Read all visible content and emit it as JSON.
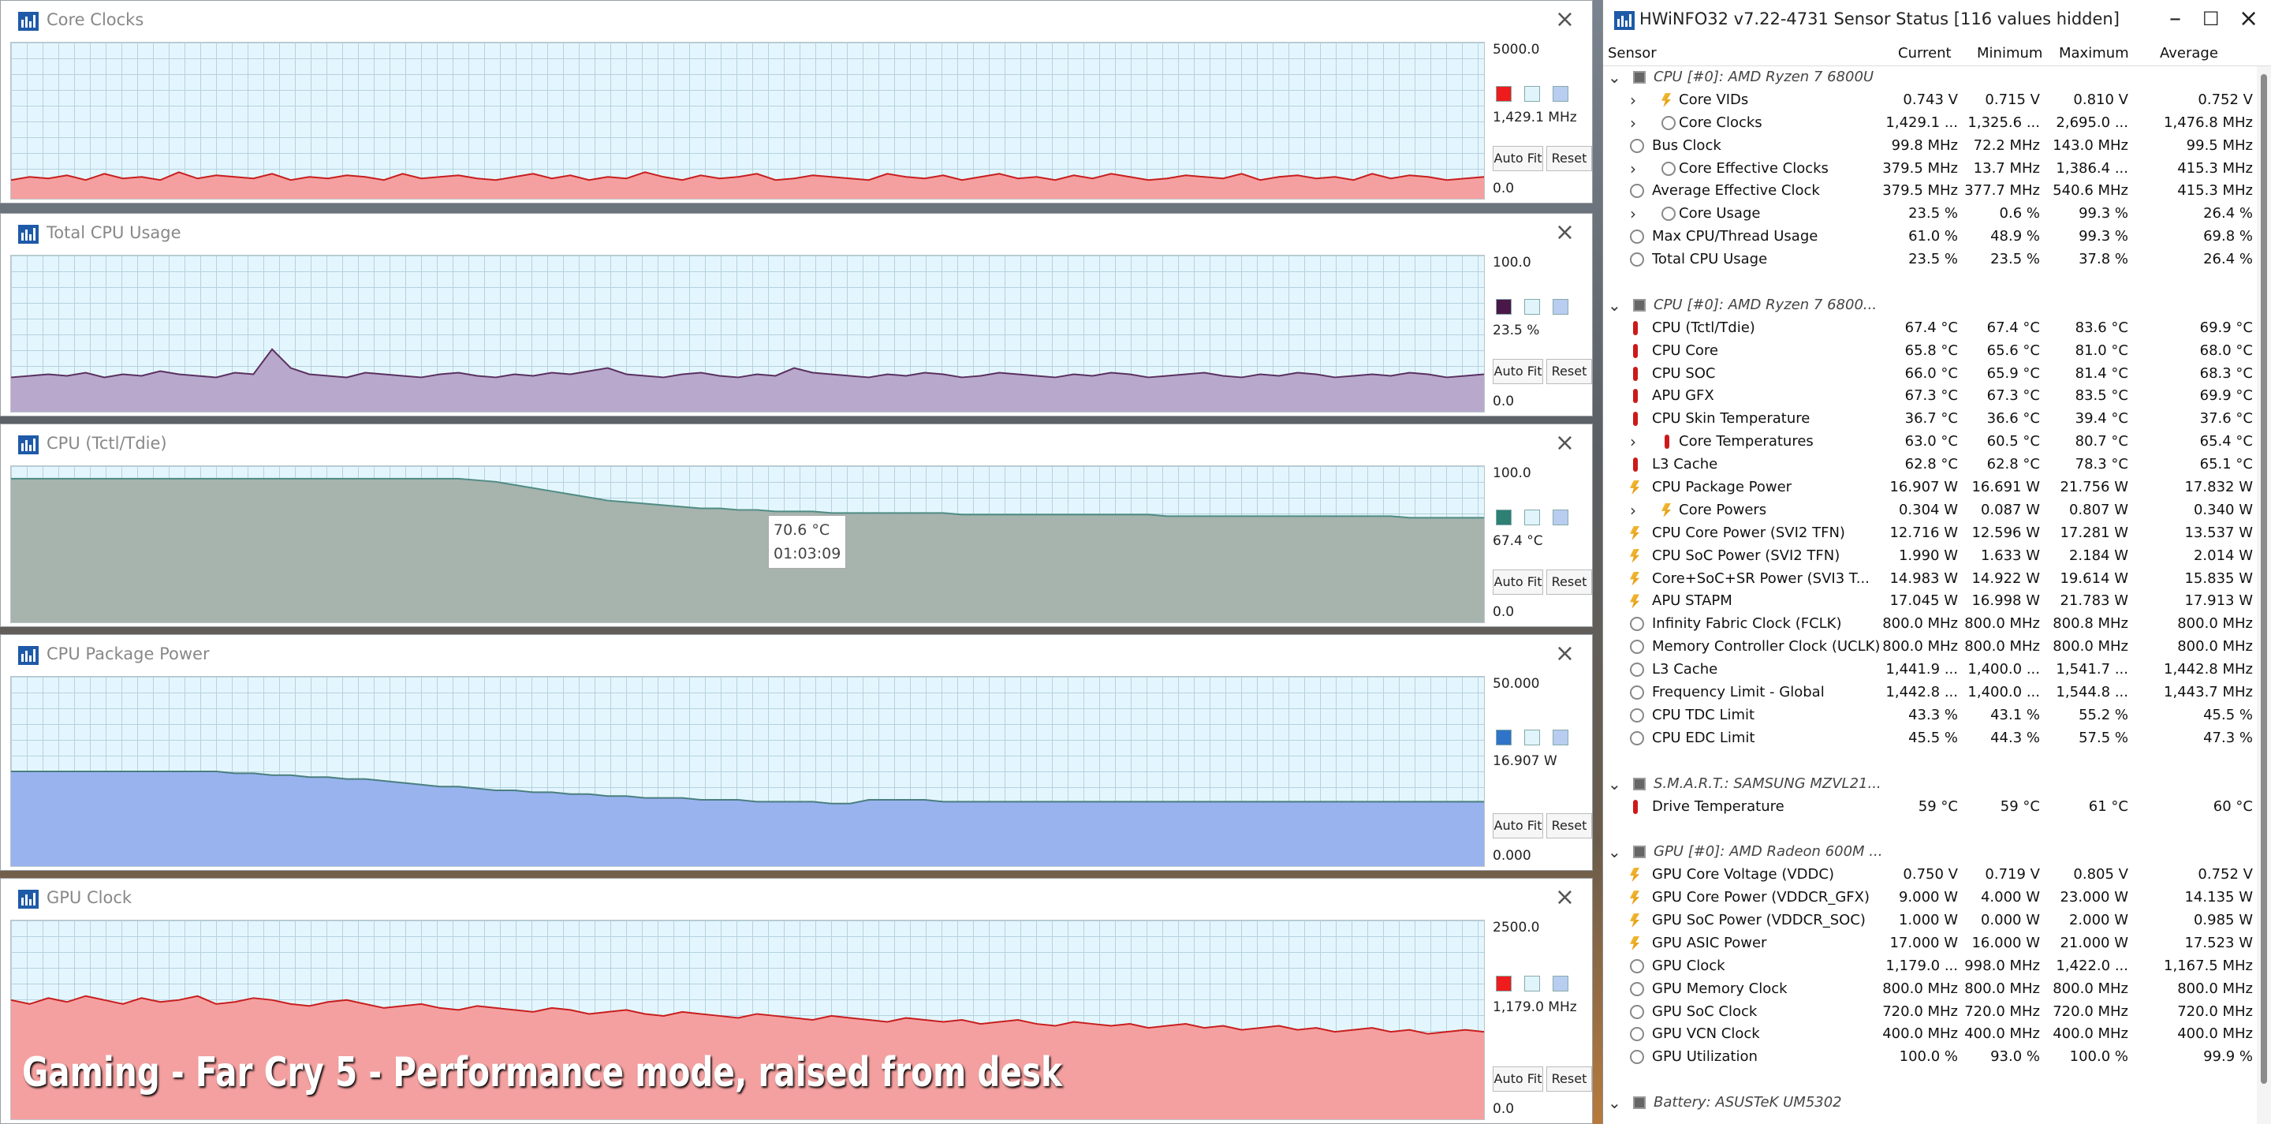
{
  "graphs": [
    {
      "title": "Core Clocks",
      "max": "5000.0",
      "current": "1,429.1 MHz",
      "min": "0.0",
      "color": "#ee1c1c",
      "fill": "#f5a0a0",
      "line": "#c81e1e",
      "level": 0.286,
      "series": [
        12,
        14,
        13,
        15,
        12,
        16,
        13,
        14,
        12,
        17,
        13,
        15,
        14,
        13,
        16,
        12,
        14,
        13,
        15,
        14,
        12,
        16,
        13,
        14,
        15,
        13,
        12,
        14,
        16,
        13,
        15,
        12,
        14,
        13,
        17,
        14,
        12,
        15,
        13,
        14,
        16,
        12,
        13,
        15,
        14,
        13,
        12,
        16,
        14,
        13,
        15,
        12,
        14,
        16,
        13,
        14,
        12,
        15,
        13,
        16,
        14,
        12,
        13,
        15,
        14,
        13,
        16,
        12,
        14,
        15,
        13,
        14,
        12,
        16,
        13,
        15,
        14,
        12,
        13,
        14
      ]
    },
    {
      "title": "Total CPU Usage",
      "max": "100.0",
      "current": "23.5 %",
      "min": "0.0",
      "color": "#4a1848",
      "fill": "#b8a8cc",
      "line": "#5a3060",
      "level": 0.235,
      "series": [
        22,
        23,
        24,
        23,
        25,
        22,
        24,
        23,
        26,
        24,
        23,
        22,
        25,
        24,
        40,
        28,
        24,
        23,
        22,
        25,
        24,
        23,
        22,
        24,
        25,
        23,
        22,
        24,
        23,
        25,
        24,
        26,
        28,
        24,
        23,
        22,
        24,
        25,
        23,
        22,
        24,
        23,
        28,
        25,
        24,
        23,
        22,
        24,
        23,
        25,
        24,
        22,
        23,
        25,
        24,
        23,
        22,
        24,
        23,
        25,
        24,
        22,
        23,
        24,
        25,
        23,
        22,
        24,
        23,
        25,
        24,
        22,
        23,
        24,
        23,
        25,
        24,
        22,
        23,
        24
      ]
    },
    {
      "title": "CPU (Tctl/Tdie)",
      "max": "100.0",
      "current": "67.4 °C",
      "min": "0.0",
      "color": "#2e7f74",
      "fill": "#a7b3ad",
      "line": "#4f8c84",
      "level": 0.674,
      "series": [
        92,
        92,
        92,
        92,
        92,
        92,
        92,
        92,
        92,
        92,
        92,
        92,
        92,
        92,
        92,
        92,
        92,
        92,
        92,
        92,
        92,
        92,
        92,
        92,
        92,
        91,
        90,
        88,
        86,
        84,
        82,
        80,
        78,
        77,
        76,
        75,
        74,
        73,
        73,
        72,
        72,
        71,
        71,
        71,
        70,
        70,
        70,
        70,
        70,
        70,
        70,
        69,
        69,
        69,
        69,
        69,
        69,
        69,
        69,
        69,
        69,
        69,
        68,
        68,
        68,
        68,
        68,
        68,
        68,
        68,
        68,
        68,
        68,
        68,
        68,
        67,
        67,
        67,
        67,
        67
      ],
      "tooltip": {
        "value": "70.6 °C",
        "time": "01:03:09"
      }
    },
    {
      "title": "CPU Package Power",
      "max": "50.000",
      "current": "16.907 W",
      "min": "0.000",
      "color": "#2f74c8",
      "fill": "#99b3ef",
      "line": "#4a7f7f",
      "level": 0.338,
      "series": [
        50,
        50,
        50,
        50,
        50,
        50,
        50,
        50,
        50,
        50,
        50,
        50,
        49,
        49,
        48,
        48,
        47,
        47,
        46,
        46,
        45,
        44,
        43,
        42,
        42,
        41,
        40,
        40,
        39,
        39,
        38,
        38,
        37,
        37,
        36,
        36,
        36,
        35,
        35,
        35,
        34,
        34,
        34,
        34,
        33,
        33,
        35,
        35,
        35,
        35,
        34,
        34,
        34,
        34,
        34,
        34,
        34,
        34,
        34,
        34,
        34,
        34,
        34,
        34,
        34,
        34,
        34,
        34,
        34,
        34,
        34,
        34,
        34,
        34,
        34,
        34,
        34,
        34,
        34,
        34
      ]
    },
    {
      "title": "GPU Clock",
      "max": "2500.0",
      "current": "1,179.0 MHz",
      "min": "0.0",
      "color": "#ee1c1c",
      "fill": "#f5a0a0",
      "line": "#c81e1e",
      "level": 0.472,
      "series": [
        60,
        58,
        61,
        59,
        62,
        60,
        58,
        61,
        59,
        60,
        62,
        58,
        59,
        61,
        60,
        58,
        57,
        59,
        60,
        58,
        56,
        57,
        58,
        56,
        55,
        57,
        56,
        55,
        54,
        56,
        55,
        53,
        54,
        55,
        53,
        52,
        54,
        53,
        52,
        51,
        53,
        52,
        51,
        50,
        52,
        51,
        50,
        49,
        51,
        50,
        49,
        50,
        48,
        49,
        50,
        48,
        47,
        49,
        48,
        47,
        48,
        46,
        47,
        48,
        46,
        47,
        45,
        46,
        47,
        45,
        46,
        44,
        45,
        46,
        44,
        45,
        43,
        44,
        45,
        44
      ]
    }
  ],
  "controls": {
    "autofit": "Auto Fit",
    "reset": "Reset"
  },
  "caption": "Gaming - Far Cry 5 - Performance mode, raised from desk",
  "sensor": {
    "title": "HWiNFO32 v7.22-4731 Sensor Status [116 values hidden]",
    "headers": {
      "sensor": "Sensor",
      "current": "Current",
      "minimum": "Minimum",
      "maximum": "Maximum",
      "average": "Average"
    },
    "rows": [
      {
        "t": "group",
        "name": "CPU [#0]: AMD Ryzen 7 6800U"
      },
      {
        "t": "row",
        "sub": true,
        "exp": true,
        "icon": "bolt",
        "name": "Core VIDs",
        "cur": "0.743 V",
        "min": "0.715 V",
        "max": "0.810 V",
        "avg": "0.752 V"
      },
      {
        "t": "row",
        "sub": true,
        "exp": true,
        "icon": "clock",
        "name": "Core Clocks",
        "cur": "1,429.1 ...",
        "min": "1,325.6 ...",
        "max": "2,695.0 ...",
        "avg": "1,476.8 MHz"
      },
      {
        "t": "row",
        "icon": "clock",
        "name": "Bus Clock",
        "cur": "99.8 MHz",
        "min": "72.2 MHz",
        "max": "143.0 MHz",
        "avg": "99.5 MHz"
      },
      {
        "t": "row",
        "sub": true,
        "exp": true,
        "icon": "clock",
        "name": "Core Effective Clocks",
        "cur": "379.5 MHz",
        "min": "13.7 MHz",
        "max": "1,386.4 ...",
        "avg": "415.3 MHz"
      },
      {
        "t": "row",
        "icon": "clock",
        "name": "Average Effective Clock",
        "cur": "379.5 MHz",
        "min": "377.7 MHz",
        "max": "540.6 MHz",
        "avg": "415.3 MHz"
      },
      {
        "t": "row",
        "sub": true,
        "exp": true,
        "icon": "clock",
        "name": "Core Usage",
        "cur": "23.5 %",
        "min": "0.6 %",
        "max": "99.3 %",
        "avg": "26.4 %"
      },
      {
        "t": "row",
        "icon": "clock",
        "name": "Max CPU/Thread Usage",
        "cur": "61.0 %",
        "min": "48.9 %",
        "max": "99.3 %",
        "avg": "69.8 %"
      },
      {
        "t": "row",
        "icon": "clock",
        "name": "Total CPU Usage",
        "cur": "23.5 %",
        "min": "23.5 %",
        "max": "37.8 %",
        "avg": "26.4 %"
      },
      {
        "t": "blank"
      },
      {
        "t": "group",
        "name": "CPU [#0]: AMD Ryzen 7 6800..."
      },
      {
        "t": "row",
        "icon": "therm",
        "name": "CPU (Tctl/Tdie)",
        "cur": "67.4 °C",
        "min": "67.4 °C",
        "max": "83.6 °C",
        "avg": "69.9 °C"
      },
      {
        "t": "row",
        "icon": "therm",
        "name": "CPU Core",
        "cur": "65.8 °C",
        "min": "65.6 °C",
        "max": "81.0 °C",
        "avg": "68.0 °C"
      },
      {
        "t": "row",
        "icon": "therm",
        "name": "CPU SOC",
        "cur": "66.0 °C",
        "min": "65.9 °C",
        "max": "81.4 °C",
        "avg": "68.3 °C"
      },
      {
        "t": "row",
        "icon": "therm",
        "name": "APU GFX",
        "cur": "67.3 °C",
        "min": "67.3 °C",
        "max": "83.5 °C",
        "avg": "69.9 °C"
      },
      {
        "t": "row",
        "icon": "therm",
        "name": "CPU Skin Temperature",
        "cur": "36.7 °C",
        "min": "36.6 °C",
        "max": "39.4 °C",
        "avg": "37.6 °C"
      },
      {
        "t": "row",
        "sub": true,
        "exp": true,
        "icon": "therm",
        "name": "Core Temperatures",
        "cur": "63.0 °C",
        "min": "60.5 °C",
        "max": "80.7 °C",
        "avg": "65.4 °C"
      },
      {
        "t": "row",
        "icon": "therm",
        "name": "L3 Cache",
        "cur": "62.8 °C",
        "min": "62.8 °C",
        "max": "78.3 °C",
        "avg": "65.1 °C"
      },
      {
        "t": "row",
        "icon": "bolt",
        "name": "CPU Package Power",
        "cur": "16.907 W",
        "min": "16.691 W",
        "max": "21.756 W",
        "avg": "17.832 W"
      },
      {
        "t": "row",
        "sub": true,
        "exp": true,
        "icon": "bolt",
        "name": "Core Powers",
        "cur": "0.304 W",
        "min": "0.087 W",
        "max": "0.807 W",
        "avg": "0.340 W"
      },
      {
        "t": "row",
        "icon": "bolt",
        "name": "CPU Core Power (SVI2 TFN)",
        "cur": "12.716 W",
        "min": "12.596 W",
        "max": "17.281 W",
        "avg": "13.537 W"
      },
      {
        "t": "row",
        "icon": "bolt",
        "name": "CPU SoC Power (SVI2 TFN)",
        "cur": "1.990 W",
        "min": "1.633 W",
        "max": "2.184 W",
        "avg": "2.014 W"
      },
      {
        "t": "row",
        "icon": "bolt",
        "name": "Core+SoC+SR Power (SVI3 T...",
        "cur": "14.983 W",
        "min": "14.922 W",
        "max": "19.614 W",
        "avg": "15.835 W"
      },
      {
        "t": "row",
        "icon": "bolt",
        "name": "APU STAPM",
        "cur": "17.045 W",
        "min": "16.998 W",
        "max": "21.783 W",
        "avg": "17.913 W"
      },
      {
        "t": "row",
        "icon": "clock",
        "name": "Infinity Fabric Clock (FCLK)",
        "cur": "800.0 MHz",
        "min": "800.0 MHz",
        "max": "800.8 MHz",
        "avg": "800.0 MHz"
      },
      {
        "t": "row",
        "icon": "clock",
        "name": "Memory Controller Clock (UCLK)",
        "cur": "800.0 MHz",
        "min": "800.0 MHz",
        "max": "800.0 MHz",
        "avg": "800.0 MHz"
      },
      {
        "t": "row",
        "icon": "clock",
        "name": "L3 Cache",
        "cur": "1,441.9 ...",
        "min": "1,400.0 ...",
        "max": "1,541.7 ...",
        "avg": "1,442.8 MHz"
      },
      {
        "t": "row",
        "icon": "clock",
        "name": "Frequency Limit - Global",
        "cur": "1,442.8 ...",
        "min": "1,400.0 ...",
        "max": "1,544.8 ...",
        "avg": "1,443.7 MHz"
      },
      {
        "t": "row",
        "icon": "clock",
        "name": "CPU TDC Limit",
        "cur": "43.3 %",
        "min": "43.1 %",
        "max": "55.2 %",
        "avg": "45.5 %"
      },
      {
        "t": "row",
        "icon": "clock",
        "name": "CPU EDC Limit",
        "cur": "45.5 %",
        "min": "44.3 %",
        "max": "57.5 %",
        "avg": "47.3 %"
      },
      {
        "t": "blank"
      },
      {
        "t": "group",
        "name": "S.M.A.R.T.: SAMSUNG MZVL21..."
      },
      {
        "t": "row",
        "icon": "therm",
        "name": "Drive Temperature",
        "cur": "59 °C",
        "min": "59 °C",
        "max": "61 °C",
        "avg": "60 °C"
      },
      {
        "t": "blank"
      },
      {
        "t": "group",
        "name": "GPU [#0]: AMD Radeon 600M ..."
      },
      {
        "t": "row",
        "icon": "bolt",
        "name": "GPU Core Voltage (VDDC)",
        "cur": "0.750 V",
        "min": "0.719 V",
        "max": "0.805 V",
        "avg": "0.752 V"
      },
      {
        "t": "row",
        "icon": "bolt",
        "name": "GPU Core Power (VDDCR_GFX)",
        "cur": "9.000 W",
        "min": "4.000 W",
        "max": "23.000 W",
        "avg": "14.135 W"
      },
      {
        "t": "row",
        "icon": "bolt",
        "name": "GPU SoC Power (VDDCR_SOC)",
        "cur": "1.000 W",
        "min": "0.000 W",
        "max": "2.000 W",
        "avg": "0.985 W"
      },
      {
        "t": "row",
        "icon": "bolt",
        "name": "GPU ASIC Power",
        "cur": "17.000 W",
        "min": "16.000 W",
        "max": "21.000 W",
        "avg": "17.523 W"
      },
      {
        "t": "row",
        "icon": "clock",
        "name": "GPU Clock",
        "cur": "1,179.0 ...",
        "min": "998.0 MHz",
        "max": "1,422.0 ...",
        "avg": "1,167.5 MHz"
      },
      {
        "t": "row",
        "icon": "clock",
        "name": "GPU Memory Clock",
        "cur": "800.0 MHz",
        "min": "800.0 MHz",
        "max": "800.0 MHz",
        "avg": "800.0 MHz"
      },
      {
        "t": "row",
        "icon": "clock",
        "name": "GPU SoC Clock",
        "cur": "720.0 MHz",
        "min": "720.0 MHz",
        "max": "720.0 MHz",
        "avg": "720.0 MHz"
      },
      {
        "t": "row",
        "icon": "clock",
        "name": "GPU VCN Clock",
        "cur": "400.0 MHz",
        "min": "400.0 MHz",
        "max": "400.0 MHz",
        "avg": "400.0 MHz"
      },
      {
        "t": "row",
        "icon": "clock",
        "name": "GPU Utilization",
        "cur": "100.0 %",
        "min": "93.0 %",
        "max": "100.0 %",
        "avg": "99.9 %"
      },
      {
        "t": "blank"
      },
      {
        "t": "group",
        "name": "Battery: ASUSTeK UM5302"
      }
    ]
  }
}
